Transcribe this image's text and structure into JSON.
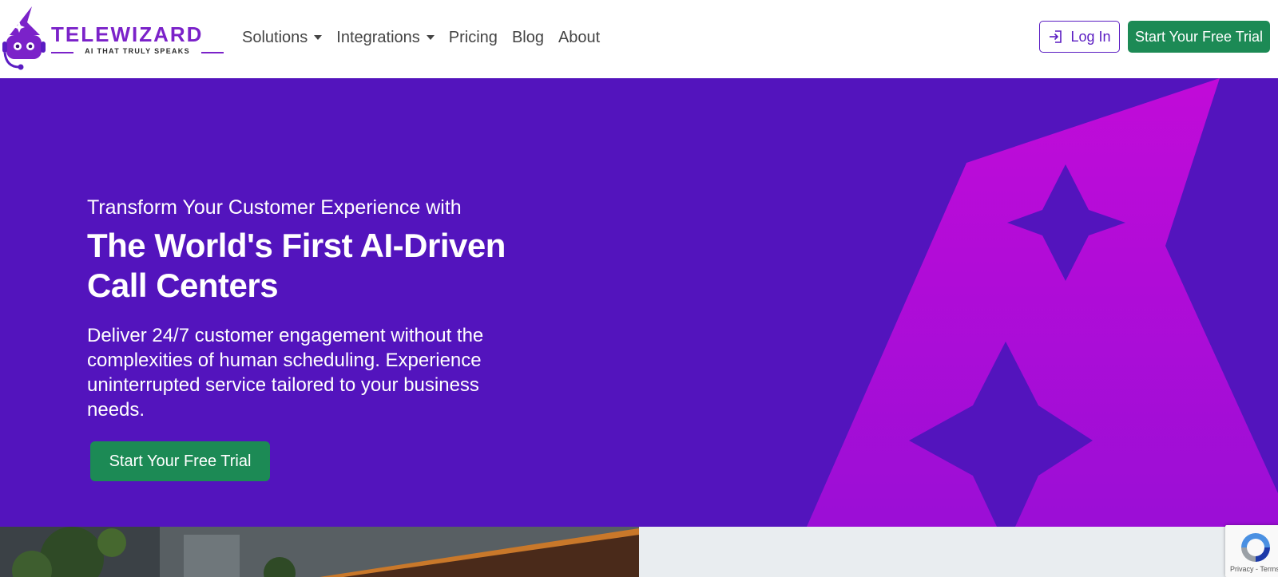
{
  "brand": {
    "name": "TELEWIZARD",
    "tagline": "AI THAT TRULY SPEAKS",
    "primary_color": "#5314bd",
    "accent_color": "#c20ed6",
    "cta_color": "#1c8a55",
    "logo_icon": "wizard-robot-mascot"
  },
  "nav": {
    "items": [
      {
        "label": "Solutions",
        "has_dropdown": true
      },
      {
        "label": "Integrations",
        "has_dropdown": true
      },
      {
        "label": "Pricing",
        "has_dropdown": false
      },
      {
        "label": "Blog",
        "has_dropdown": false
      },
      {
        "label": "About",
        "has_dropdown": false
      }
    ],
    "login_label": "Log In",
    "login_icon": "sign-in-icon",
    "trial_label": "Start Your Free Trial"
  },
  "hero": {
    "kicker": "Transform Your Customer Experience with",
    "title": "The World's First AI-Driven Call Centers",
    "description": "Deliver 24/7 customer engagement without the complexities of human scheduling. Experience uninterrupted service tailored to your business needs.",
    "cta_label": "Start Your Free Trial"
  },
  "recaptcha": {
    "text": "Privacy - Terms",
    "icon": "recaptcha-icon"
  }
}
